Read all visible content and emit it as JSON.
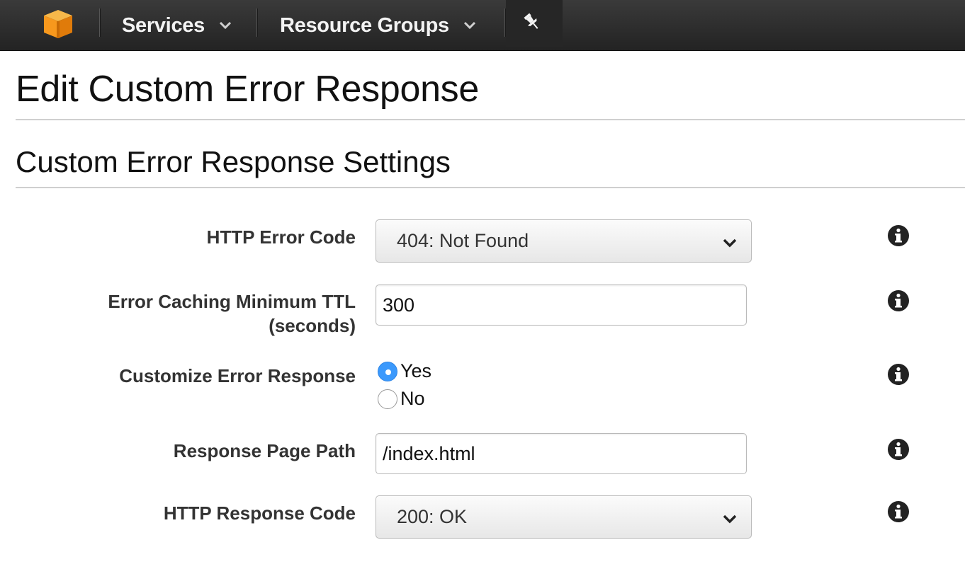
{
  "nav": {
    "services_label": "Services",
    "resource_groups_label": "Resource Groups",
    "icons": [
      "aws-cube-logo",
      "chevron-down-icon",
      "pin-icon"
    ]
  },
  "page": {
    "title": "Edit Custom Error Response",
    "section_title": "Custom Error Response Settings"
  },
  "form": {
    "http_error_code": {
      "label": "HTTP Error Code",
      "value": "404: Not Found"
    },
    "error_caching_ttl": {
      "label_line1": "Error Caching Minimum TTL",
      "label_line2": "(seconds)",
      "value": "300"
    },
    "customize_error_response": {
      "label": "Customize Error Response",
      "options": [
        {
          "label": "Yes",
          "selected": true
        },
        {
          "label": "No",
          "selected": false
        }
      ]
    },
    "response_page_path": {
      "label": "Response Page Path",
      "value": "/index.html"
    },
    "http_response_code": {
      "label": "HTTP Response Code",
      "value": "200: OK"
    }
  },
  "colors": {
    "nav_bg": "#2b2b2b",
    "logo_orange": "#f7981d",
    "radio_selected": "#3b99fc"
  }
}
